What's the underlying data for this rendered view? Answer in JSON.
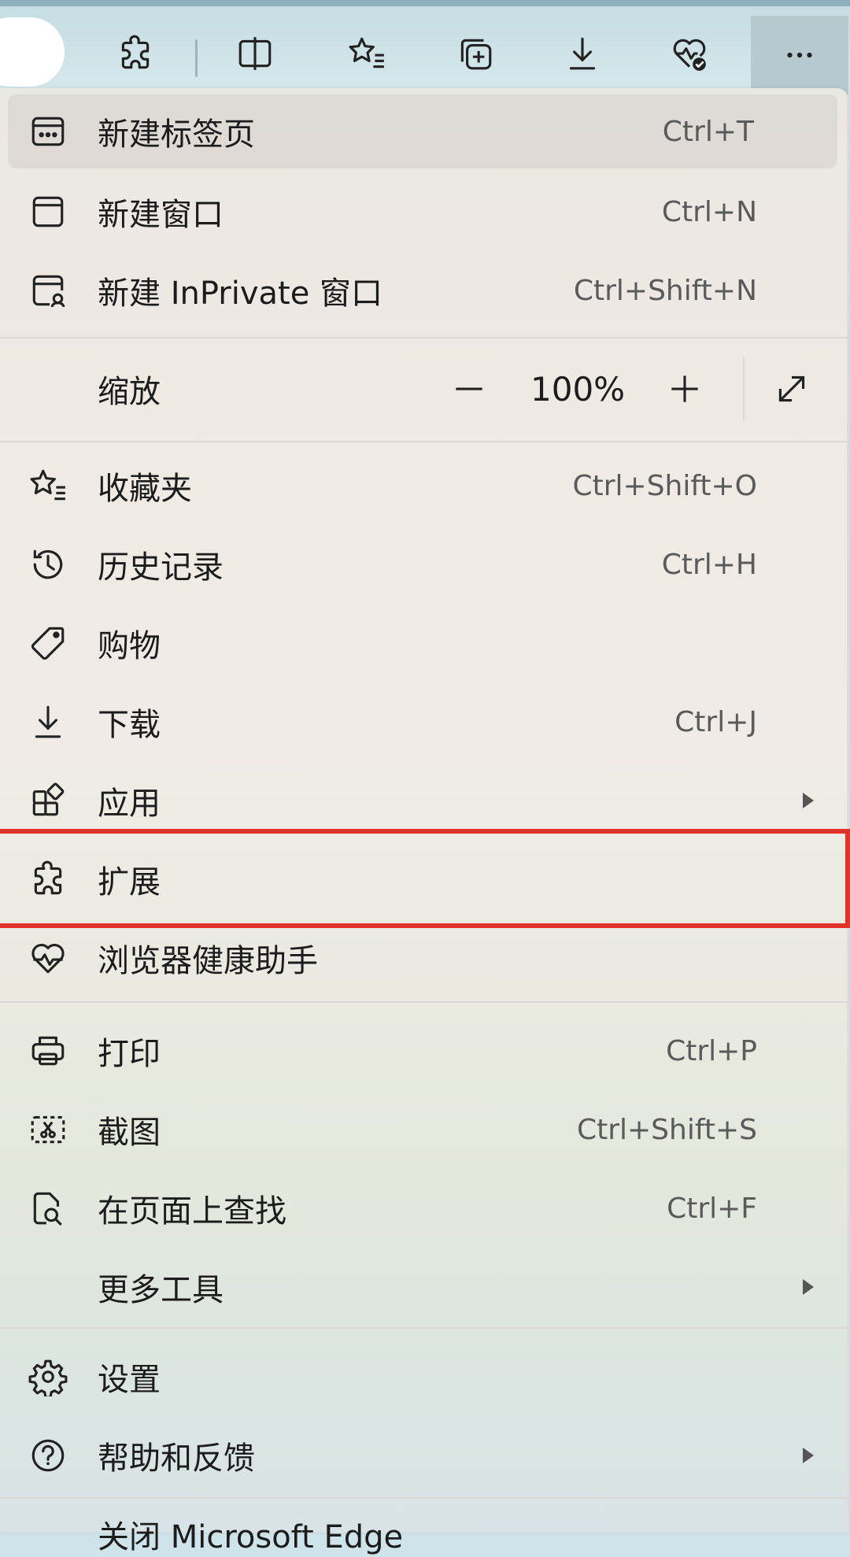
{
  "toolbar": {
    "buttons": [
      {
        "name": "extensions-icon"
      },
      {
        "name": "split-screen-icon"
      },
      {
        "name": "favorites-icon"
      },
      {
        "name": "collections-icon"
      },
      {
        "name": "downloads-icon"
      },
      {
        "name": "browser-essentials-icon"
      },
      {
        "name": "more-options-icon"
      }
    ]
  },
  "menu": {
    "new_tab": {
      "label": "新建标签页",
      "shortcut": "Ctrl+T"
    },
    "new_window": {
      "label": "新建窗口",
      "shortcut": "Ctrl+N"
    },
    "new_inprivate": {
      "label": "新建 InPrivate 窗口",
      "shortcut": "Ctrl+Shift+N"
    },
    "zoom": {
      "label": "缩放",
      "value": "100%"
    },
    "favorites": {
      "label": "收藏夹",
      "shortcut": "Ctrl+Shift+O"
    },
    "history": {
      "label": "历史记录",
      "shortcut": "Ctrl+H"
    },
    "shopping": {
      "label": "购物"
    },
    "downloads": {
      "label": "下载",
      "shortcut": "Ctrl+J"
    },
    "apps": {
      "label": "应用"
    },
    "extensions": {
      "label": "扩展"
    },
    "browser_essentials": {
      "label": "浏览器健康助手"
    },
    "print": {
      "label": "打印",
      "shortcut": "Ctrl+P"
    },
    "screenshot": {
      "label": "截图",
      "shortcut": "Ctrl+Shift+S"
    },
    "find": {
      "label": "在页面上查找",
      "shortcut": "Ctrl+F"
    },
    "more_tools": {
      "label": "更多工具"
    },
    "settings": {
      "label": "设置"
    },
    "help": {
      "label": "帮助和反馈"
    },
    "close": {
      "label": "关闭 Microsoft Edge"
    }
  },
  "colors": {
    "highlight_border": "#e0342b",
    "toolbar_bg": "#cfe4ea",
    "menu_bg": "#efe9e4"
  }
}
